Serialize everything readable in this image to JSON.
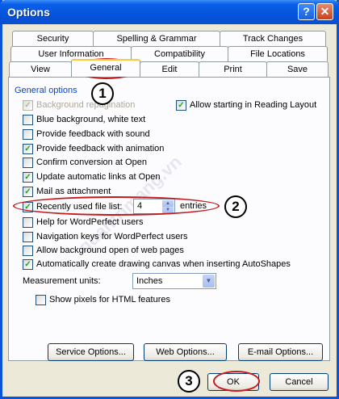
{
  "window": {
    "title": "Options"
  },
  "tabs": {
    "row1": [
      "Security",
      "Spelling & Grammar",
      "Track Changes"
    ],
    "row2": [
      "User Information",
      "Compatibility",
      "File Locations"
    ],
    "row3": [
      "View",
      "General",
      "Edit",
      "Print",
      "Save"
    ]
  },
  "general": {
    "group_label": "General options",
    "options": [
      {
        "label": "Background repagination",
        "checked": true,
        "disabled": true
      },
      {
        "label": "Blue background, white text",
        "checked": false
      },
      {
        "label": "Provide feedback with sound",
        "checked": false
      },
      {
        "label": "Provide feedback with animation",
        "checked": true
      },
      {
        "label": "Confirm conversion at Open",
        "checked": false
      },
      {
        "label": "Update automatic links at Open",
        "checked": true
      },
      {
        "label": "Mail as attachment",
        "checked": true
      },
      {
        "label": "Recently used file list:",
        "checked": true
      },
      {
        "label": "Help for WordPerfect users",
        "checked": false
      },
      {
        "label": "Navigation keys for WordPerfect users",
        "checked": false
      },
      {
        "label": "Allow background open of web pages",
        "checked": false
      },
      {
        "label": "Automatically create drawing canvas when inserting AutoShapes",
        "checked": true
      }
    ],
    "reading_layout": {
      "label": "Allow starting in Reading Layout",
      "checked": true
    },
    "recent_files": {
      "value": "4",
      "suffix": "entries"
    },
    "measurement": {
      "label": "Measurement units:",
      "value": "Inches"
    },
    "show_pixels": {
      "label": "Show pixels for HTML features",
      "checked": false
    }
  },
  "buttons": {
    "service": "Service Options...",
    "web": "Web Options...",
    "email": "E-mail Options...",
    "ok": "OK",
    "cancel": "Cancel"
  },
  "callouts": [
    "1",
    "2",
    "3"
  ],
  "watermark": "quantrimang.vn",
  "colors": {
    "titlebar": "#0554dc",
    "group_label": "#0046d5",
    "highlight": "#c31b1b"
  }
}
